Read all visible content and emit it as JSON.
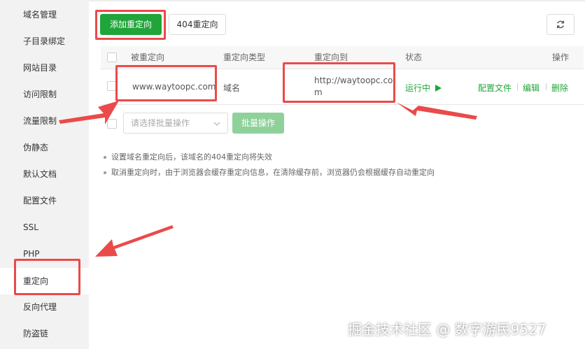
{
  "sidebar": {
    "items": [
      {
        "label": "域名管理"
      },
      {
        "label": "子目录绑定"
      },
      {
        "label": "网站目录"
      },
      {
        "label": "访问限制"
      },
      {
        "label": "流量限制"
      },
      {
        "label": "伪静态"
      },
      {
        "label": "默认文档"
      },
      {
        "label": "配置文件"
      },
      {
        "label": "SSL"
      },
      {
        "label": "PHP"
      },
      {
        "label": "重定向",
        "active": true
      },
      {
        "label": "反向代理"
      },
      {
        "label": "防盗链"
      }
    ]
  },
  "toolbar": {
    "add_label": "添加重定向",
    "redirect_404_label": "404重定向",
    "refresh_icon": "refresh-icon"
  },
  "table": {
    "headers": [
      "被重定向",
      "重定向类型",
      "重定向到",
      "状态",
      "操作"
    ],
    "rows": [
      {
        "source": "www.waytoopc.com",
        "type": "域名",
        "target_line1": "http://waytoopc.co",
        "target_line2": "m",
        "status": "运行中",
        "status_icon": "play-icon",
        "actions": [
          "配置文件",
          "编辑",
          "删除"
        ]
      }
    ]
  },
  "batch": {
    "select_placeholder": "请选择批量操作",
    "button_label": "批量操作"
  },
  "tips": [
    "设置域名重定向后，该域名的404重定向将失效",
    "取消重定向时，由于浏览器会缓存重定向信息，在清除缓存前，浏览器仍会根据缓存自动重定向"
  ],
  "watermark": "掘金技术社区 @ 数字游民9527",
  "colors": {
    "accent": "#20a53a",
    "annotation": "#ea4a4a",
    "sidebar_bg": "#f2f2f2"
  }
}
